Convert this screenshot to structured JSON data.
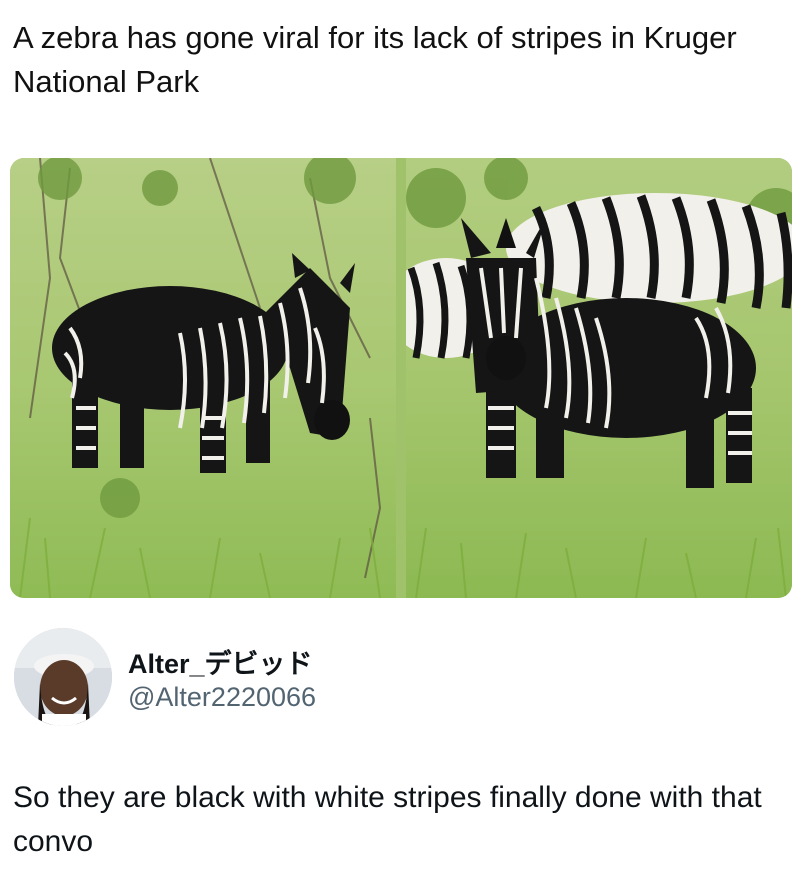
{
  "post": {
    "headline": "A zebra has gone viral for its lack of stripes in Kruger National Park"
  },
  "media": {
    "images": [
      {
        "name": "photo-left",
        "subject": "dark zebra with partial stripes standing in grass"
      },
      {
        "name": "photo-right",
        "subject": "dark zebra facing camera with striped zebras behind"
      }
    ],
    "colors": {
      "grass": "#9fc26a",
      "zebra": "#151515",
      "stripe": "#f2f0ea"
    }
  },
  "reply": {
    "display_name": "Alter_デビッド",
    "handle": "@Alter2220066",
    "text": "So they are black with white stripes finally done with that convo"
  }
}
